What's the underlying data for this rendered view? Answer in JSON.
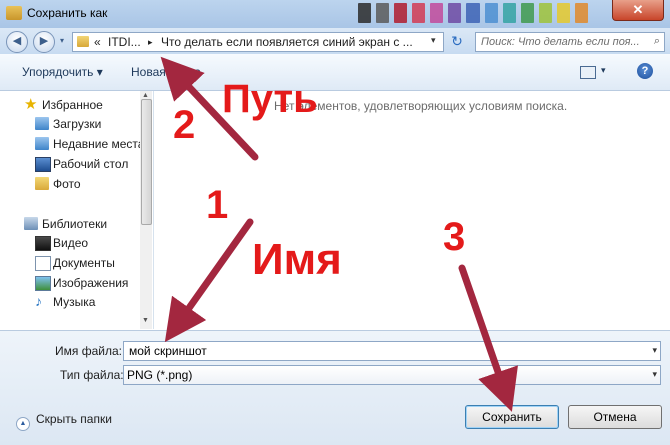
{
  "window": {
    "title": "Сохранить как",
    "close": "✕"
  },
  "nav": {
    "back": "◀",
    "forward": "▶",
    "history": "▾",
    "crumb_overflow": "«",
    "crumb_1": "ITDI...",
    "crumb_sep": "▸",
    "crumb_2": "Что делать если появляется синий экран с ...",
    "address_dropdown": "▾",
    "refresh": "↻",
    "search_placeholder": "Поиск: Что делать если поя...",
    "search_icon": "⌕"
  },
  "toolbar": {
    "organize": "Упорядочить ▾",
    "new_folder": "Новая папка",
    "view_dropdown": "▾",
    "help": "?"
  },
  "navpane": {
    "favorites": "Избранное",
    "downloads": "Загрузки",
    "recent": "Недавние места",
    "desktop": "Рабочий стол",
    "photo": "Фото",
    "libraries": "Библиотеки",
    "video": "Видео",
    "documents": "Документы",
    "images": "Изображения",
    "music": "Музыка",
    "scroll_up": "▲",
    "scroll_down": "▼"
  },
  "content": {
    "empty_message": "Нет элементов, удовлетворяющих условиям поиска."
  },
  "form": {
    "filename_label": "Имя файла:",
    "filename_value": "мой скриншот",
    "filetype_label": "Тип файла:",
    "filetype_value": "PNG (*.png)",
    "dropdown": "▾",
    "hide_folders": "Скрыть папки",
    "hide_icon": "▲",
    "save": "Сохранить",
    "cancel": "Отмена"
  },
  "annotations": {
    "label_path": "Путь",
    "label_name": "Имя",
    "num_1": "1",
    "num_2": "2",
    "num_3": "3",
    "color": "#e41a1a",
    "arrow_color": "#a3273f"
  },
  "swatch_colors": [
    "#2b2b2b",
    "#5a5a5a",
    "#b01c2e",
    "#d23b53",
    "#c24a9b",
    "#6f4aa3",
    "#3d63b5",
    "#4c8fd1",
    "#34a3a3",
    "#3f9a4d",
    "#9fc33a",
    "#e5c92c",
    "#e08a2a"
  ]
}
